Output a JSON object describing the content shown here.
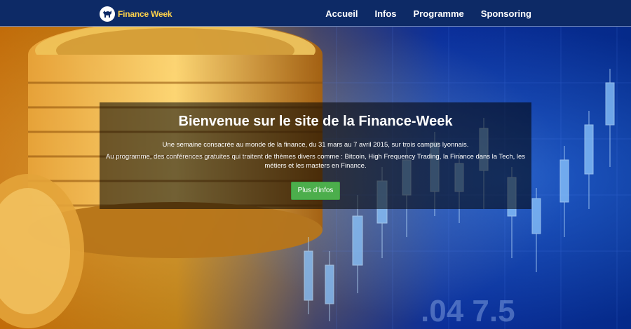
{
  "brand": {
    "name": "Finance Week",
    "logo_icon": "bull-icon"
  },
  "nav": {
    "items": [
      "Accueil",
      "Infos",
      "Programme",
      "Sponsoring"
    ]
  },
  "hero": {
    "title": "Bienvenue sur le site de la Finance-Week",
    "paragraph1": "Une semaine consacrée au monde de la finance, du 31 mars au 7 avril 2015, sur trois campus lyonnais.",
    "paragraph2": "Au programme, des conférences gratuites qui traitent de thèmes divers comme : Bitcoin, High Frequency Trading, la Finance dans la Tech, les métiers et les masters en Finance.",
    "cta_label": "Plus d'infos",
    "background": "coins-and-stock-chart-photo"
  },
  "colors": {
    "navbar": "#0d2a66",
    "brand_text": "#ffd24a",
    "cta": "#4cae4c",
    "overlay": "rgba(0,0,0,0.55)"
  }
}
